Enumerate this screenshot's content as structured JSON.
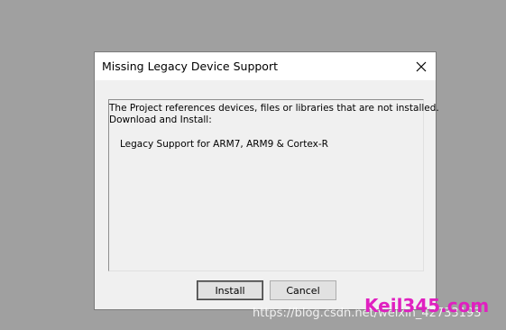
{
  "dialog": {
    "title": "Missing Legacy Device Support",
    "message_line1": "The Project references devices, files or libraries that are not installed.",
    "message_line2": "Download and Install:",
    "item": "Legacy Support for ARM7, ARM9 & Cortex-R",
    "install_label": "Install",
    "cancel_label": "Cancel"
  },
  "watermark": {
    "url": "https://blog.csdn.net/weixin_42733193",
    "logo": "Keil345.com"
  },
  "colors": {
    "desktop": "#a0a0a0",
    "dialog_bg": "#f0f0f0",
    "logo": "#e020c0"
  }
}
